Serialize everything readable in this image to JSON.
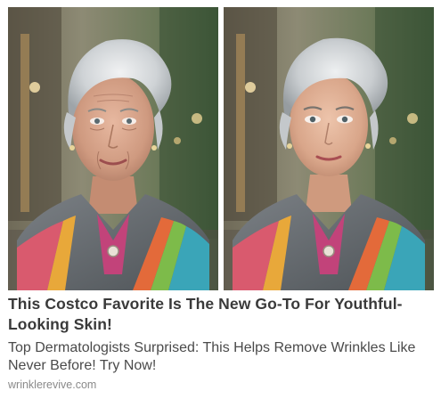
{
  "ad": {
    "headline": "This Costco Favorite Is The New Go-To For Youthful-Looking Skin!",
    "description": "Top Dermatologists Surprised: This Helps Remove Wrinkles Like Never Before! Try Now!",
    "source": "wrinklerevive.com"
  },
  "images": {
    "left": {
      "subject": "older-woman-before-photo"
    },
    "right": {
      "subject": "younger-looking-woman-after-photo"
    }
  },
  "colors": {
    "headline": "#3a3a3a",
    "description": "#4a4a4a",
    "source": "#8a8a8a",
    "hair": "#cfd3d6",
    "jacket": "#6e7378"
  }
}
